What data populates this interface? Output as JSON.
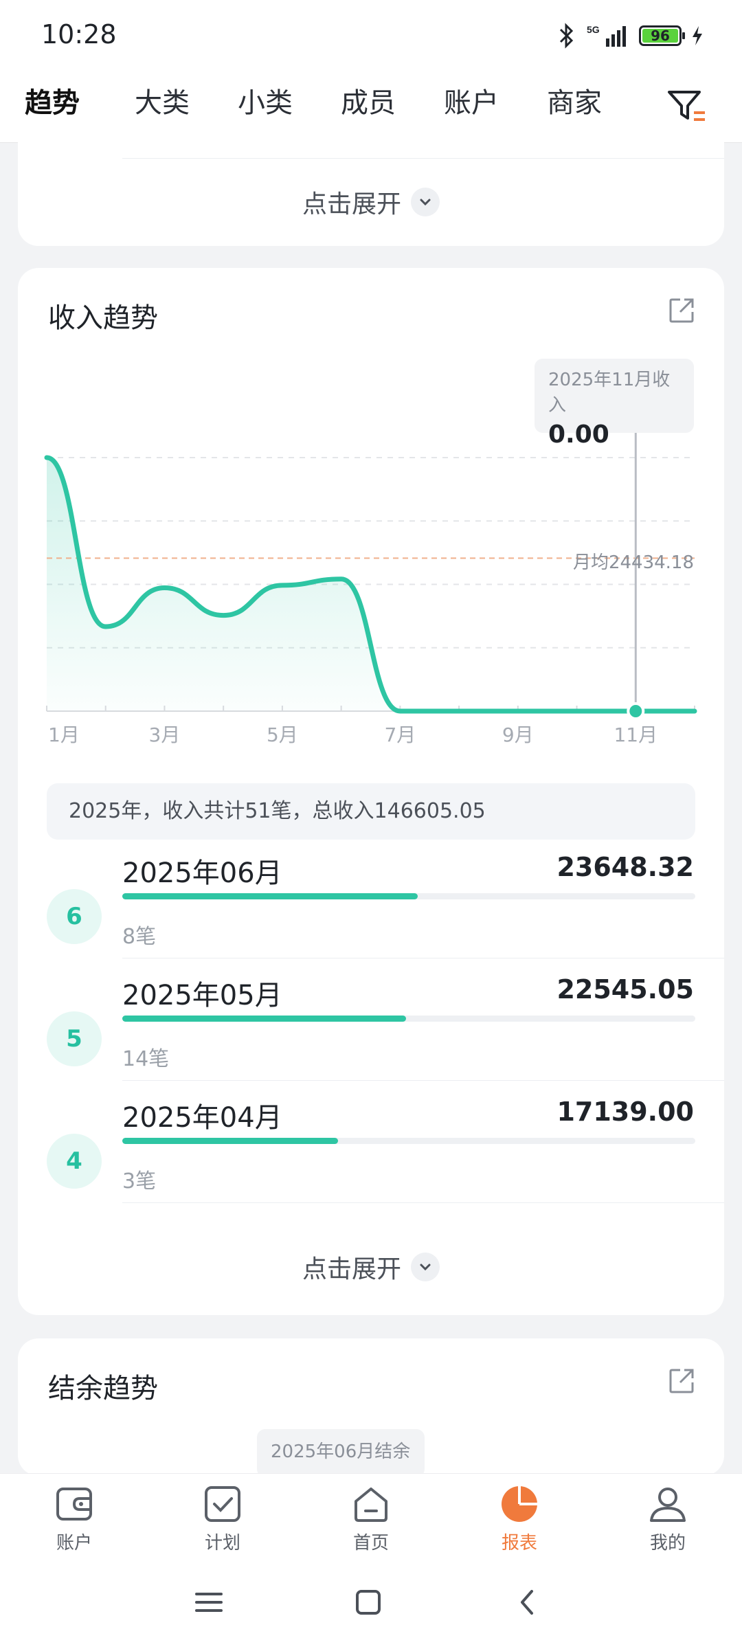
{
  "status_bar": {
    "time": "10:28",
    "network": "5G",
    "battery": "96"
  },
  "tabs": [
    {
      "label": "趋势",
      "active": true
    },
    {
      "label": "大类"
    },
    {
      "label": "小类"
    },
    {
      "label": "成员"
    },
    {
      "label": "账户"
    },
    {
      "label": "商家"
    }
  ],
  "top_card": {
    "expand_label": "点击展开"
  },
  "income_card": {
    "title": "收入趋势",
    "tooltip": {
      "title": "2025年11月收入",
      "value": "0.00"
    },
    "average_label": "月均24434.18",
    "summary": "2025年，收入共计51笔，总收入146605.05",
    "expand_label": "点击展开",
    "ranking": [
      {
        "rank": "6",
        "month": "2025年06月",
        "amount": "23648.32",
        "count": "8笔",
        "share": 0.515
      },
      {
        "rank": "5",
        "month": "2025年05月",
        "amount": "22545.05",
        "count": "14笔",
        "share": 0.495
      },
      {
        "rank": "4",
        "month": "2025年04月",
        "amount": "17139.00",
        "count": "3笔",
        "share": 0.376
      }
    ]
  },
  "chart_data": {
    "type": "area",
    "x": [
      1,
      2,
      3,
      4,
      5,
      6,
      7,
      8,
      9,
      10,
      11,
      12
    ],
    "x_tick_labels": [
      "1月",
      "3月",
      "5月",
      "7月",
      "9月",
      "11月"
    ],
    "values": [
      40500,
      13500,
      19700,
      15300,
      20100,
      21100,
      0,
      0,
      0,
      0,
      0,
      0
    ],
    "average": 24434.18,
    "highlight": {
      "x": 11,
      "label": "2025年11月收入",
      "value": 0.0
    },
    "ylim": [
      0,
      40500
    ],
    "grid": true,
    "colors": {
      "line": "#2ec5a3",
      "average": "#f0b08c"
    }
  },
  "balance_card": {
    "title": "结余趋势",
    "tooltip_title": "2025年06月结余"
  },
  "bottom_nav": [
    {
      "label": "账户",
      "icon": "wallet-icon"
    },
    {
      "label": "计划",
      "icon": "checkbox-icon"
    },
    {
      "label": "首页",
      "icon": "home-icon"
    },
    {
      "label": "报表",
      "icon": "pie-chart-icon",
      "active": true
    },
    {
      "label": "我的",
      "icon": "person-icon"
    }
  ],
  "colors": {
    "accent": "#f07a3c",
    "teal": "#2ec5a3",
    "background": "#f2f3f5"
  }
}
